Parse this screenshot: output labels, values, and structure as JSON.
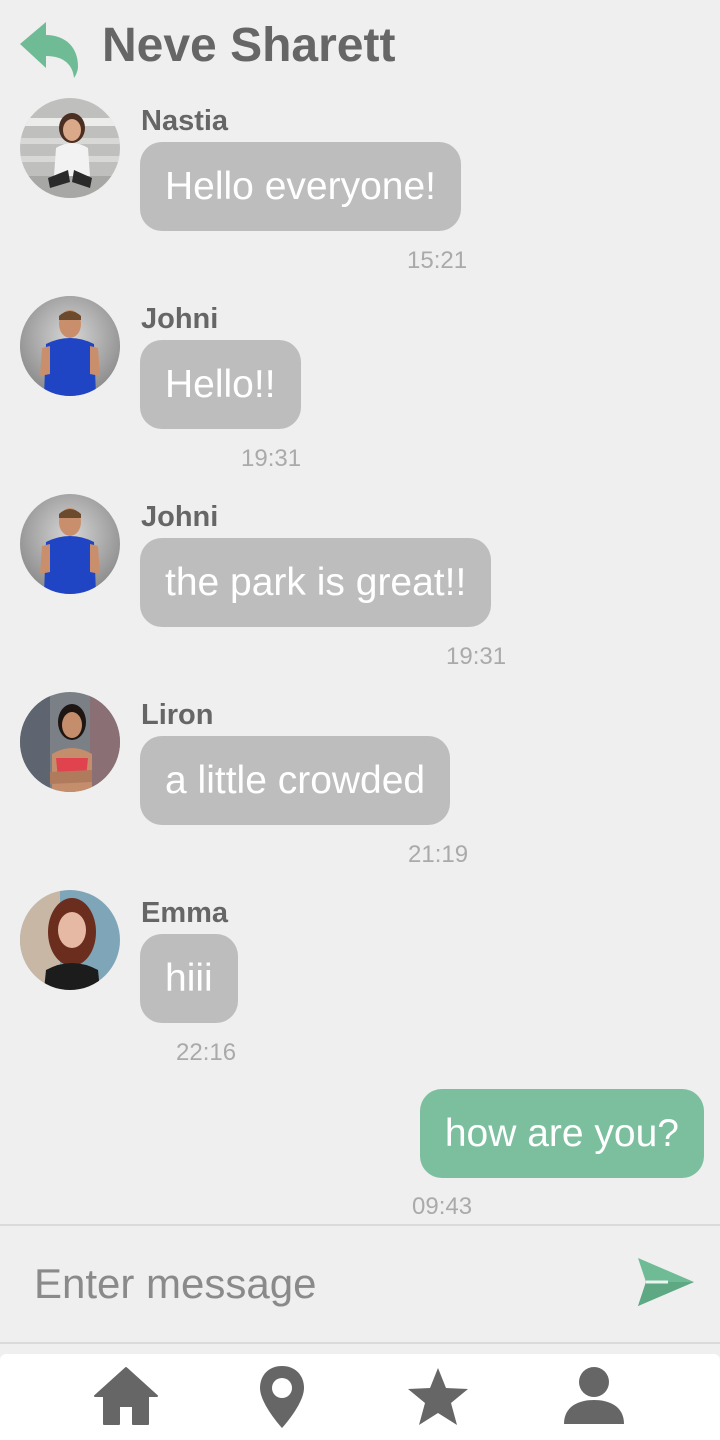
{
  "header": {
    "title": "Neve Sharett",
    "back_icon": "reply-arrow-icon",
    "back_icon_color": "#6fbb95"
  },
  "messages": [
    {
      "sender": "Nastia",
      "text": "Hello everyone!",
      "time": "15:21"
    },
    {
      "sender": "Johni",
      "text": "Hello!!",
      "time": "19:31"
    },
    {
      "sender": "Johni",
      "text": "the park is great!!",
      "time": "19:31"
    },
    {
      "sender": "Liron",
      "text": "a little crowded",
      "time": "21:19"
    },
    {
      "sender": "Emma",
      "text": "hiii",
      "time": "22:16"
    }
  ],
  "own_message": {
    "text": "how are you?",
    "time": "09:43"
  },
  "composer": {
    "placeholder": "Enter message",
    "send_icon": "send-paper-plane-icon"
  },
  "nav": {
    "items": [
      {
        "icon": "home-icon"
      },
      {
        "icon": "location-pin-icon"
      },
      {
        "icon": "star-icon"
      },
      {
        "icon": "profile-icon"
      }
    ]
  },
  "colors": {
    "background": "#efefef",
    "incoming_bubble": "#bdbdbd",
    "outgoing_bubble": "#7bbf9e",
    "text_dark": "#666666",
    "timestamp": "#aaaaaa",
    "accent": "#6fbb95"
  }
}
